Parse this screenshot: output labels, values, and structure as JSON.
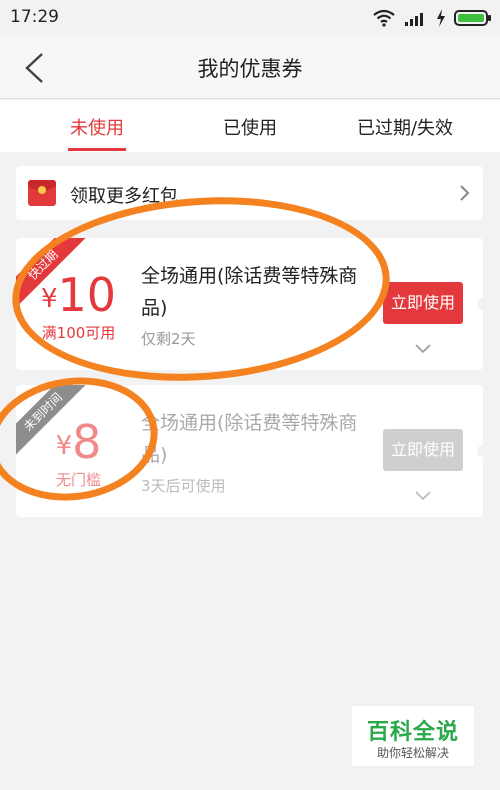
{
  "status_bar": {
    "time": "17:29"
  },
  "header": {
    "title": "我的优惠券"
  },
  "tabs": [
    {
      "label": "未使用",
      "active": true
    },
    {
      "label": "已使用",
      "active": false
    },
    {
      "label": "已过期/失效",
      "active": false
    }
  ],
  "redpacket": {
    "label": "领取更多红包"
  },
  "coupons": [
    {
      "ribbon": "快过期",
      "currency": "¥",
      "amount": "10",
      "condition": "满100可用",
      "title": "全场通用(除话费等特殊商品)",
      "subtitle": "仅剩2天",
      "button": "立即使用",
      "state": "active"
    },
    {
      "ribbon": "未到时间",
      "currency": "¥",
      "amount": "8",
      "condition": "无门槛",
      "title": "全场通用(除话费等特殊商品)",
      "subtitle": "3天后可使用",
      "button": "立即使用",
      "state": "disabled"
    }
  ],
  "watermark": {
    "title": "百科全说",
    "subtitle": "助你轻松解决"
  },
  "colors": {
    "accent": "#e4393c",
    "annotation": "#f58220",
    "watermark": "#2aa94a"
  }
}
